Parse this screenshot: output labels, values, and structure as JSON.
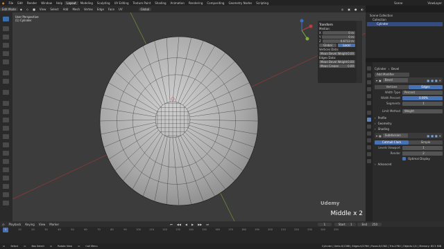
{
  "topbar": {
    "menus": [
      "File",
      "Edit",
      "Render",
      "Window",
      "Help"
    ],
    "workspaces": [
      "Layout",
      "Modeling",
      "Sculpting",
      "UV Editing",
      "Texture Paint",
      "Shading",
      "Animation",
      "Rendering",
      "Compositing",
      "Geometry Nodes",
      "Scripting"
    ],
    "active_workspace": "Layout",
    "scene": "Scene",
    "view_layer": "ViewLayer"
  },
  "viewport_header": {
    "mode": "Edit Mode",
    "menus": [
      "View",
      "Select",
      "Add",
      "Mesh",
      "Vertex",
      "Edge",
      "Face",
      "UV"
    ],
    "orientation": "Global"
  },
  "viewport": {
    "perspective": "User Perspective",
    "object": "(1) Cylinder",
    "overlay_text": "Middle x 2",
    "watermark": "Udemy"
  },
  "npanel": {
    "title": "Transform",
    "median_label": "Median:",
    "x_label": "X",
    "x_value": "0 m",
    "y_label": "Y",
    "y_value": "0 m",
    "z_label": "Z",
    "z_value": "0.6713 m",
    "global": "Global",
    "local": "Local",
    "vertices_data": "Vertices Data:",
    "mean_bevel_weight_v": "Mean Bevel Weight",
    "mbw_v_val": "0.00",
    "edges_data": "Edges Data:",
    "mean_bevel_weight_e": "Mean Bevel Weight",
    "mbw_e_val": "0.00",
    "mean_crease": "Mean Crease",
    "crease_val": "0.00"
  },
  "outliner": {
    "items": [
      "Scene Collection",
      "Collection",
      "Cylinder"
    ]
  },
  "properties": {
    "breadcrumb_obj": "Cylinder",
    "breadcrumb_mod": "Bevel",
    "add_modifier": "Add Modifier",
    "bevel": {
      "name": "Bevel",
      "vertices": "Vertices",
      "edges": "Edges",
      "width_type_label": "Width Type",
      "width_type": "Percent",
      "width_percent_label": "Width Percent",
      "width_percent": "0.00%",
      "segments_label": "Segments",
      "segments": "1",
      "limit_method_label": "Limit Method",
      "limit_method": "Weight",
      "profile": "Profile",
      "geometry": "Geometry",
      "shading": "Shading"
    },
    "subdivision": {
      "name": "Subdivision",
      "catmull": "Catmull-Clark",
      "simple": "Simple",
      "levels_viewport_label": "Levels Viewport",
      "levels_viewport": "1",
      "render_label": "Render",
      "render": "2",
      "optimal_display": "Optimal Display",
      "advanced": "Advanced"
    }
  },
  "timeline": {
    "menus": [
      "Playback",
      "Keying",
      "View",
      "Marker"
    ],
    "current_frame": "1",
    "start_label": "Start",
    "start": "1",
    "end_label": "End",
    "end": "250",
    "ticks": [
      "0",
      "10",
      "20",
      "30",
      "40",
      "50",
      "60",
      "70",
      "80",
      "90",
      "100",
      "110",
      "120",
      "130",
      "140",
      "150",
      "160",
      "170",
      "180",
      "190",
      "200",
      "210",
      "220",
      "230",
      "240",
      "250"
    ]
  },
  "statusbar": {
    "select": "Select",
    "box_select": "Box Select",
    "rotate_view": "Rotate View",
    "call_menu": "Call Menu",
    "stats": "Cylinder | Verts:0/1388 | Edges:0/2768 | Faces:0/1382 | Tris:2760 | Objects:1/1 | Memory: 63.5 MiB"
  },
  "colors": {
    "accent": "#4772b3",
    "x_axis": "#c43b3b",
    "y_axis": "#7ab03a"
  }
}
